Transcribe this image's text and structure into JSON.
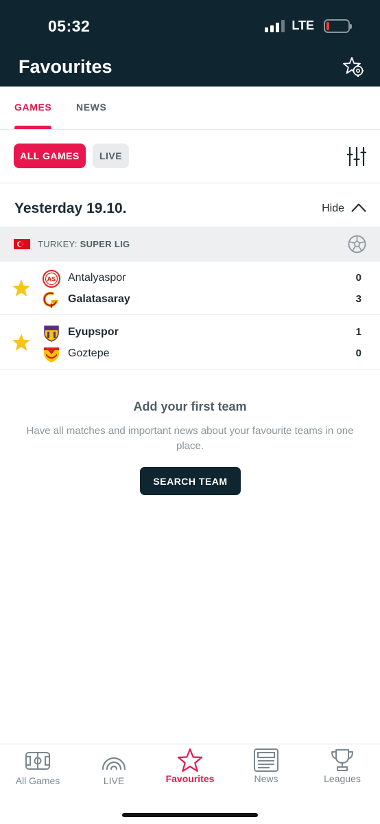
{
  "status_bar": {
    "time": "05:32",
    "network": "LTE"
  },
  "header": {
    "title": "Favourites",
    "settings_icon": "star-gear-icon"
  },
  "tabs": [
    {
      "label": "GAMES",
      "active": true
    },
    {
      "label": "NEWS",
      "active": false
    }
  ],
  "filters": {
    "all_games_label": "ALL GAMES",
    "live_label": "LIVE",
    "settings_icon": "sliders-icon"
  },
  "day_section": {
    "date_label": "Yesterday 19.10.",
    "toggle_label": "Hide"
  },
  "league": {
    "country": "TURKEY: ",
    "name": "SUPER LIG",
    "sport_icon": "football-icon"
  },
  "matches": [
    {
      "favourite": true,
      "home": {
        "name": "Antalyaspor",
        "score": "0",
        "winner": false
      },
      "away": {
        "name": "Galatasaray",
        "score": "3",
        "winner": true
      }
    },
    {
      "favourite": true,
      "home": {
        "name": "Eyupspor",
        "score": "1",
        "winner": true
      },
      "away": {
        "name": "Goztepe",
        "score": "0",
        "winner": false
      }
    }
  ],
  "empty_state": {
    "title": "Add your first team",
    "text": "Have all matches and important news about your favourite teams in one place.",
    "button_label": "SEARCH TEAM"
  },
  "bottom_nav": [
    {
      "label": "All Games",
      "icon": "pitch-icon",
      "active": false
    },
    {
      "label": "LIVE",
      "icon": "live-signal-icon",
      "active": false
    },
    {
      "label": "Favourites",
      "icon": "star-icon",
      "active": true
    },
    {
      "label": "News",
      "icon": "newspaper-icon",
      "active": false
    },
    {
      "label": "Leagues",
      "icon": "trophy-icon",
      "active": false
    }
  ],
  "colors": {
    "header_bg": "#0f2630",
    "accent": "#e8174e",
    "favourite_star": "#f5c518",
    "battery_low": "#ff3b30"
  }
}
